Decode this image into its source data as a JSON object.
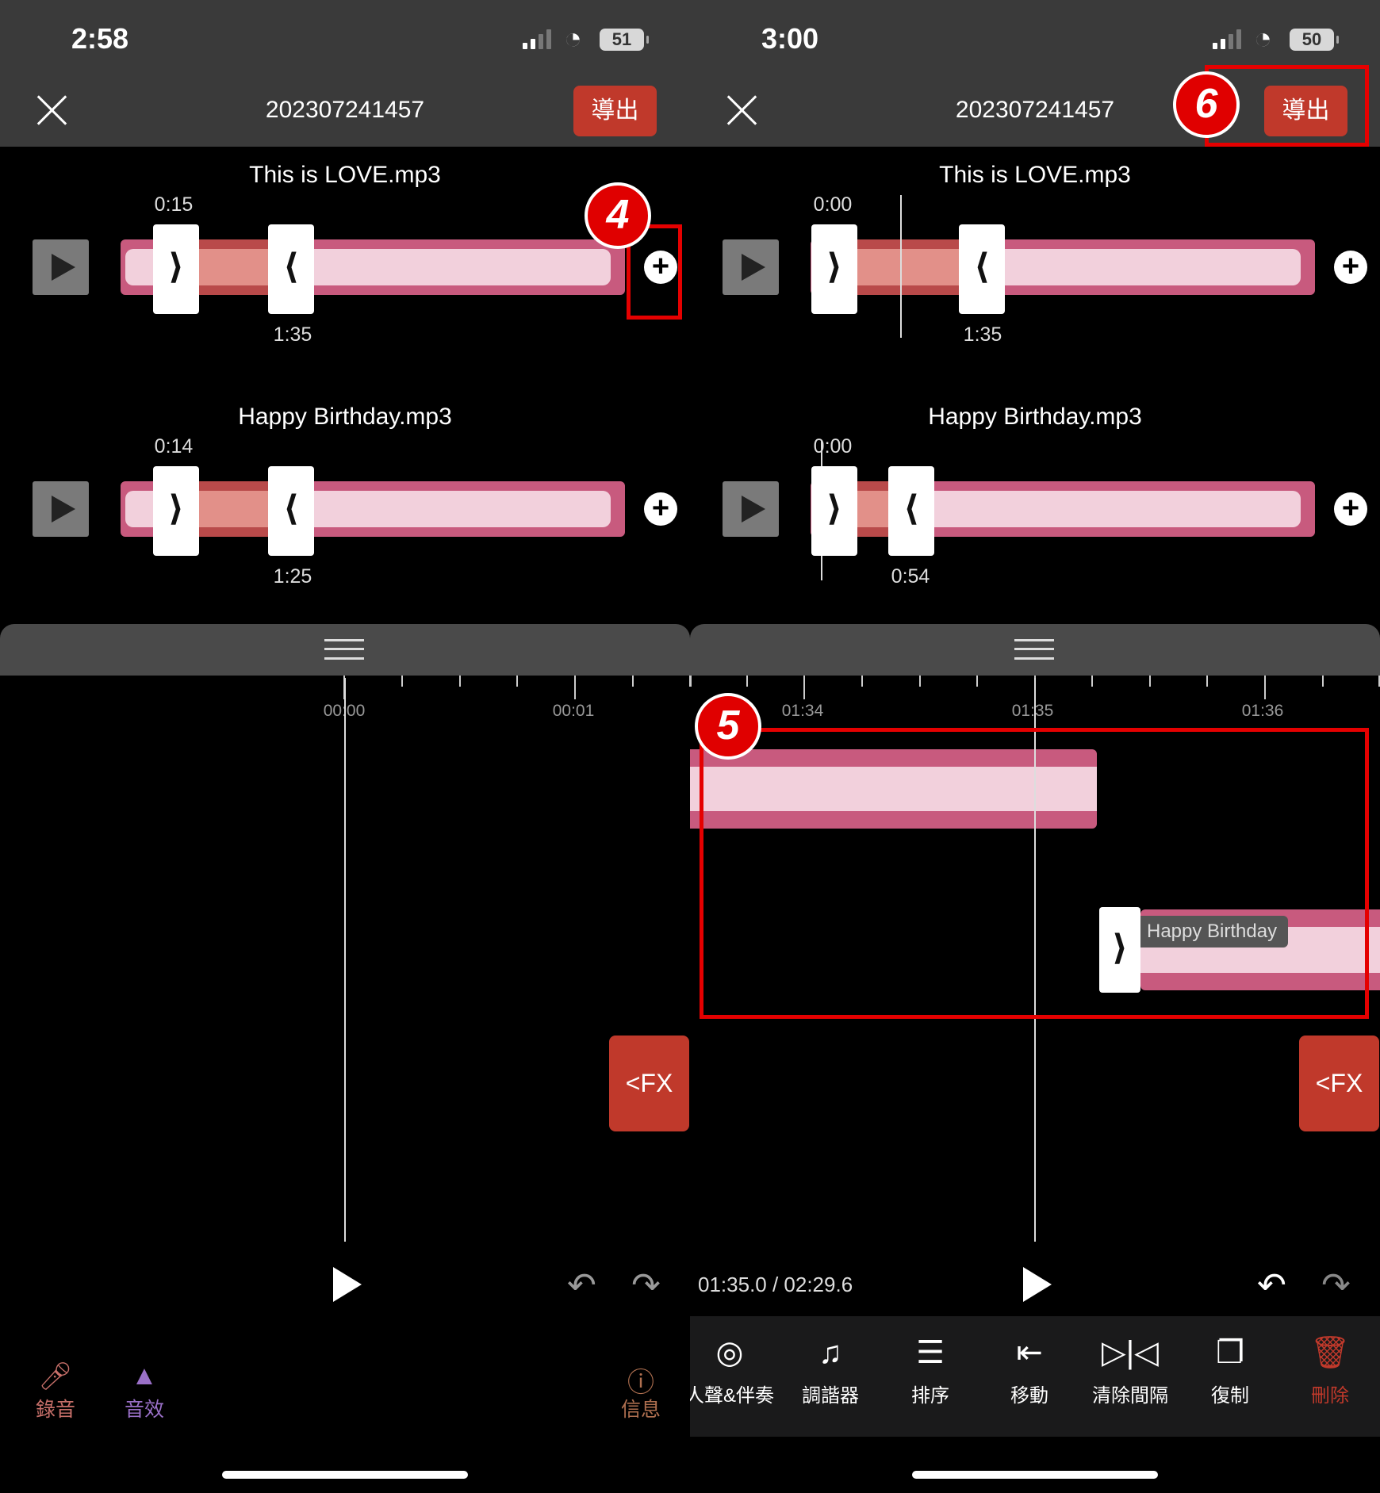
{
  "left": {
    "status": {
      "time": "2:58",
      "battery": "51"
    },
    "header": {
      "title": "202307241457",
      "export_label": "導出"
    },
    "tracks": [
      {
        "title": "This is LOVE.mp3",
        "start": "0:15",
        "end": "1:35"
      },
      {
        "title": "Happy Birthday.mp3",
        "start": "0:14",
        "end": "1:25"
      }
    ],
    "ruler": [
      "00:00",
      "00:01"
    ],
    "fx_label": "<FX",
    "bottom_tabs": [
      {
        "label": "錄音",
        "icon": "microphone-icon",
        "color": "#c8706a"
      },
      {
        "label": "音效",
        "icon": "flame-icon",
        "color": "#9a70c8"
      },
      {
        "label": "信息",
        "icon": "info-icon",
        "color": "#b07050"
      }
    ],
    "badge": "4"
  },
  "right": {
    "status": {
      "time": "3:00",
      "battery": "50"
    },
    "header": {
      "title": "202307241457",
      "export_label": "導出"
    },
    "tracks": [
      {
        "title": "This is LOVE.mp3",
        "start": "0:00",
        "end": "1:35"
      },
      {
        "title": "Happy Birthday.mp3",
        "start": "0:00",
        "end": "0:54"
      }
    ],
    "ruler": [
      "01:34",
      "01:35",
      "01:36"
    ],
    "clip_label": "Happy Birthday",
    "fx_label": "<FX",
    "position": "01:35.0 / 02:29.6",
    "toolbar": [
      {
        "label": "人聲&伴奏",
        "icon": "vocal-disc-icon"
      },
      {
        "label": "調諧器",
        "icon": "music-notes-icon"
      },
      {
        "label": "排序",
        "icon": "numbered-list-icon"
      },
      {
        "label": "移動",
        "icon": "move-left-icon"
      },
      {
        "label": "清除間隔",
        "icon": "remove-gap-icon"
      },
      {
        "label": "復制",
        "icon": "copy-icon"
      },
      {
        "label": "刪除",
        "icon": "trash-icon",
        "color": "#c0392b"
      }
    ],
    "badges": [
      "5",
      "6"
    ]
  },
  "colors": {
    "accent": "#c0392b",
    "wave": "#c85a7e",
    "wave_light": "#f2d0dc",
    "highlight_box": "#e50000"
  }
}
